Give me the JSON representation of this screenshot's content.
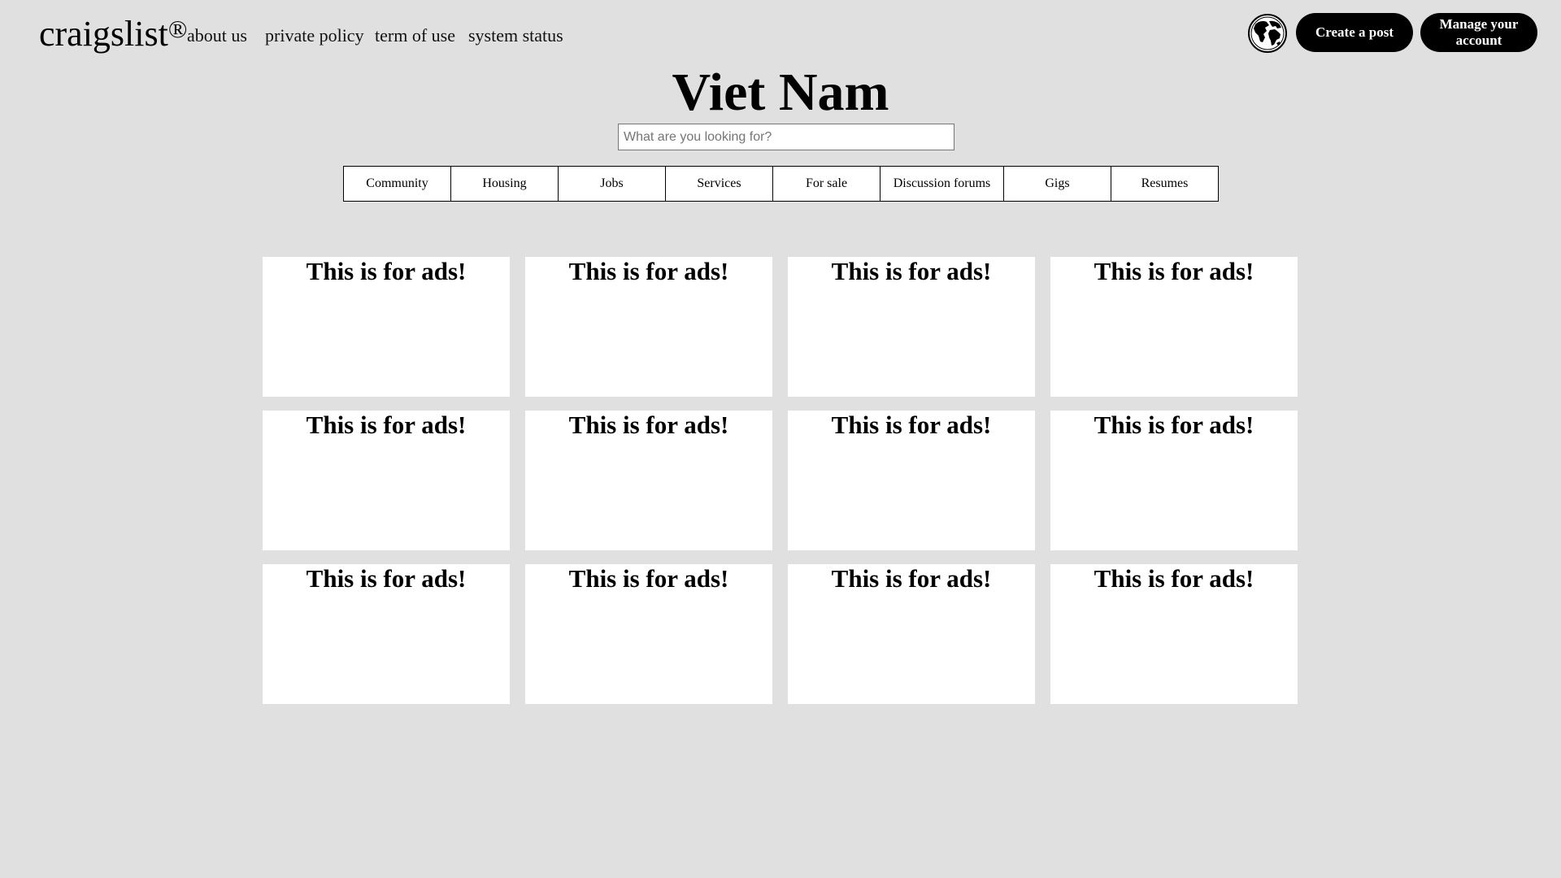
{
  "header": {
    "brand": "craigslist",
    "brand_mark": "®",
    "nav": [
      {
        "label": "about us"
      },
      {
        "label": "private policy"
      },
      {
        "label": "term of use"
      },
      {
        "label": "system status"
      }
    ],
    "globe_icon": "globe-icon",
    "create_post_label": "Create a post",
    "manage_account_label": "Manage your account"
  },
  "main": {
    "title": "Viet Nam",
    "search": {
      "placeholder": "What are you looking for?",
      "value": ""
    },
    "categories": [
      {
        "label": "Community"
      },
      {
        "label": "Housing"
      },
      {
        "label": "Jobs"
      },
      {
        "label": "Services"
      },
      {
        "label": "For sale"
      },
      {
        "label": "Discussion forums"
      },
      {
        "label": "Gigs"
      },
      {
        "label": "Resumes"
      }
    ],
    "ads": [
      {
        "text": "This is for ads!"
      },
      {
        "text": "This is for ads!"
      },
      {
        "text": "This is for ads!"
      },
      {
        "text": "This is for ads!"
      },
      {
        "text": "This is for ads!"
      },
      {
        "text": "This is for ads!"
      },
      {
        "text": "This is for ads!"
      },
      {
        "text": "This is for ads!"
      },
      {
        "text": "This is for ads!"
      },
      {
        "text": "This is for ads!"
      },
      {
        "text": "This is for ads!"
      },
      {
        "text": "This is for ads!"
      }
    ]
  },
  "colors": {
    "background": "#e0e0e0",
    "button": "#000000",
    "button_text": "#ffffff",
    "card": "#ffffff"
  }
}
